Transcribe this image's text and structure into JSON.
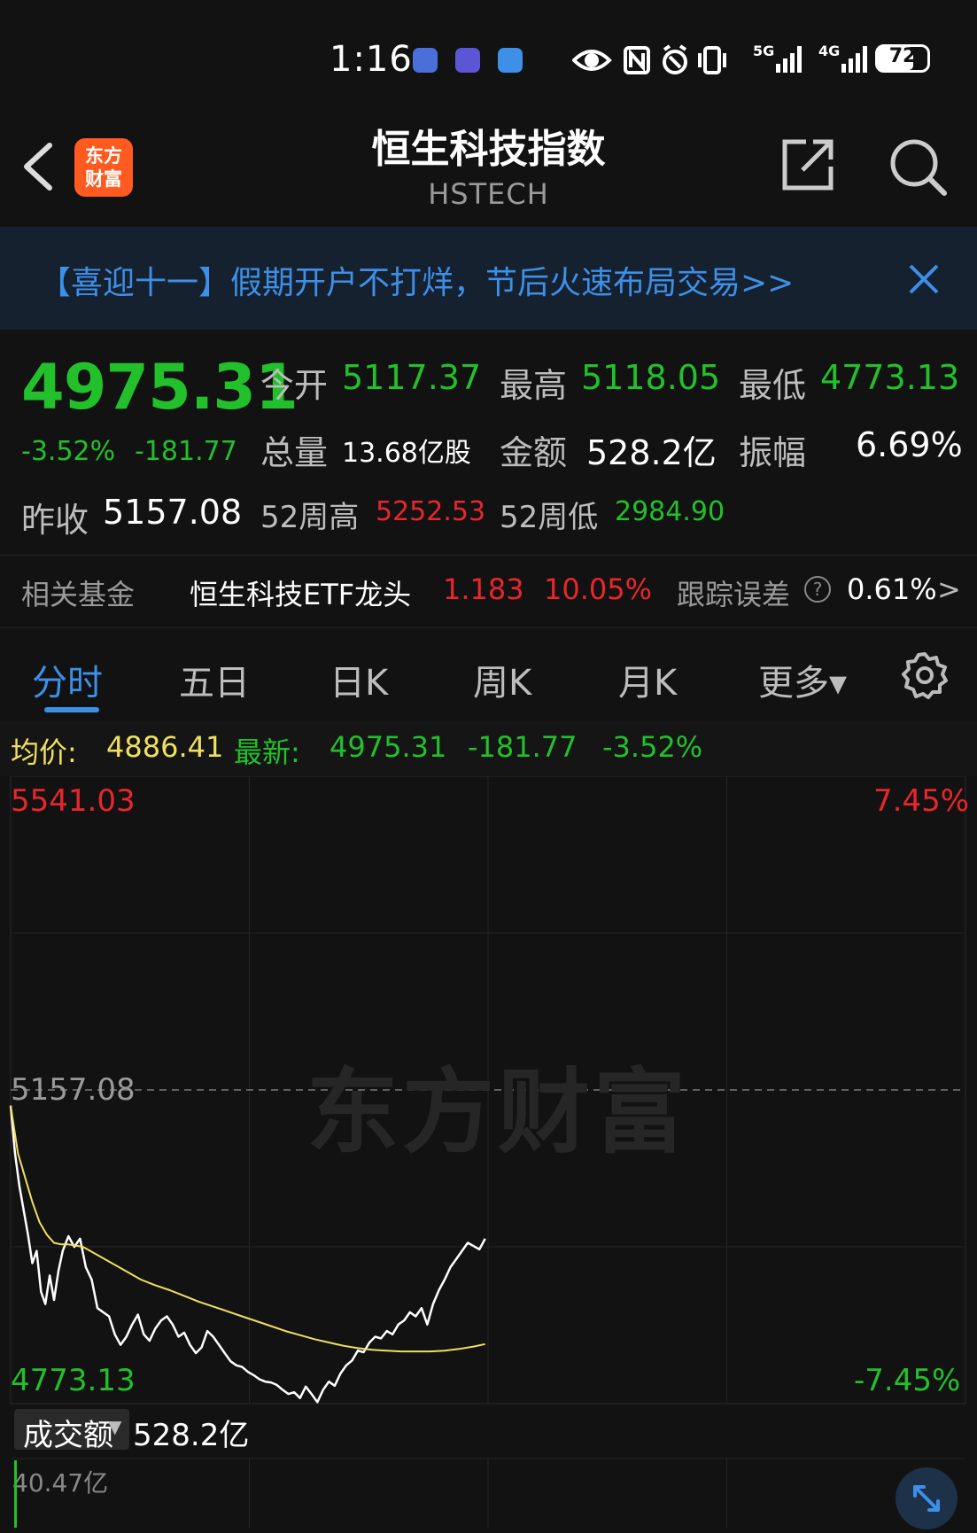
{
  "status_bar": {
    "time": "1:16",
    "icons": [
      "eye-icon",
      "nfc-icon",
      "alarm-icon",
      "vibrate-icon",
      "5g-signal-icon",
      "4g-signal-icon"
    ],
    "network_5g": "5G",
    "network_4g": "4G",
    "battery": "72"
  },
  "header": {
    "logo_line1": "东方",
    "logo_line2": "财富",
    "title": "恒生科技指数",
    "subtitle": "HSTECH"
  },
  "banner": {
    "text": "【喜迎十一】假期开户不打烊，节后火速布局交易>>",
    "accent": "#3d8fe8"
  },
  "quote": {
    "price": "4975.31",
    "change_pct": "-3.52%",
    "change_abs": "-181.77",
    "open_label": "今开",
    "open": "5117.37",
    "high_label": "最高",
    "high": "5118.05",
    "low_label": "最低",
    "low": "4773.13",
    "volume_label": "总量",
    "volume": "13.68亿股",
    "amount_label": "金额",
    "amount": "528.2亿",
    "amplitude_label": "振幅",
    "amplitude": "6.69%",
    "prev_close_label": "昨收",
    "prev_close": "5157.08",
    "w52_high_label": "52周高",
    "w52_high": "5252.53",
    "w52_low_label": "52周低",
    "w52_low": "2984.90"
  },
  "related_fund": {
    "label": "相关基金",
    "name": "恒生科技ETF龙头",
    "price": "1.183",
    "change": "10.05%",
    "tracking_label": "跟踪误差",
    "tracking_error": "0.61%",
    "more": ">"
  },
  "tabs": [
    {
      "label": "分时",
      "active": true
    },
    {
      "label": "五日",
      "active": false
    },
    {
      "label": "日K",
      "active": false
    },
    {
      "label": "周K",
      "active": false
    },
    {
      "label": "月K",
      "active": false
    },
    {
      "label": "更多▾",
      "active": false
    }
  ],
  "info_line": {
    "avg_label": "均价:",
    "avg": "4886.41",
    "latest_label": "最新:",
    "latest": "4975.31",
    "change_abs": "-181.77",
    "change_pct": "-3.52%"
  },
  "chart_data": {
    "type": "line",
    "y_max_label": "5541.03",
    "y_mid_label": "5157.08",
    "y_min_label": "4773.13",
    "pct_max_label": "7.45%",
    "pct_min_label": "-7.45%",
    "ylim": [
      4773.13,
      5541.03
    ],
    "prev_close": 5157.08,
    "xlim": [
      0,
      330
    ],
    "series": [
      {
        "name": "最新",
        "color": "#ffffff",
        "x": [
          0,
          3,
          6,
          9,
          12,
          15,
          18,
          21,
          24,
          27,
          30,
          33,
          36,
          40,
          44,
          48,
          52,
          56,
          60,
          64,
          68,
          72,
          76,
          80,
          84,
          88,
          92,
          96,
          100,
          104,
          108,
          112,
          116,
          120,
          124,
          128,
          132,
          136,
          140,
          144,
          148,
          152,
          156,
          160,
          164,
          168,
          172,
          176,
          180,
          184,
          188,
          192,
          196,
          200,
          204,
          208,
          212,
          216,
          220,
          224,
          228,
          232,
          236,
          240,
          244,
          248,
          252,
          256,
          260,
          264,
          268,
          272,
          276,
          280,
          284,
          288,
          292,
          296,
          300,
          304,
          308,
          312,
          316,
          320,
          324,
          328
        ],
        "y": [
          5138,
          5080,
          5040,
          5010,
          4980,
          4945,
          4960,
          4910,
          4895,
          4930,
          4900,
          4935,
          4960,
          4978,
          4965,
          4975,
          4940,
          4925,
          4890,
          4885,
          4880,
          4858,
          4845,
          4855,
          4870,
          4882,
          4858,
          4850,
          4865,
          4875,
          4880,
          4870,
          4855,
          4860,
          4845,
          4835,
          4842,
          4862,
          4855,
          4845,
          4835,
          4825,
          4820,
          4818,
          4812,
          4808,
          4803,
          4800,
          4799,
          4796,
          4790,
          4785,
          4787,
          4780,
          4794,
          4785,
          4775,
          4790,
          4800,
          4795,
          4810,
          4820,
          4826,
          4838,
          4836,
          4848,
          4855,
          4853,
          4862,
          4858,
          4870,
          4875,
          4885,
          4880,
          4890,
          4870,
          4895,
          4912,
          4925,
          4940,
          4950,
          4960,
          4970,
          4966,
          4962,
          4975
        ]
      },
      {
        "name": "均价",
        "color": "#f0e060",
        "x": [
          0,
          5,
          10,
          15,
          20,
          25,
          30,
          35,
          40,
          50,
          60,
          70,
          80,
          90,
          100,
          110,
          120,
          130,
          140,
          150,
          160,
          170,
          180,
          190,
          200,
          210,
          220,
          230,
          240,
          250,
          260,
          270,
          280,
          290,
          300,
          310,
          320,
          328
        ],
        "y": [
          5138,
          5080,
          5050,
          5020,
          4995,
          4980,
          4970,
          4968,
          4968,
          4965,
          4955,
          4945,
          4935,
          4925,
          4918,
          4912,
          4905,
          4898,
          4892,
          4886,
          4880,
          4874,
          4868,
          4862,
          4857,
          4852,
          4848,
          4844,
          4841,
          4839,
          4838,
          4837,
          4837,
          4837,
          4838,
          4840,
          4843,
          4846
        ]
      }
    ],
    "grid": true
  },
  "watermark": "东方财富",
  "volume": {
    "selector_label": "成交额",
    "value": "528.2亿",
    "max_label": "40.47亿"
  },
  "colors": {
    "down": "#22c02a",
    "up": "#e8262b",
    "accent": "#3d8fe8",
    "avg_line": "#f0e060"
  }
}
